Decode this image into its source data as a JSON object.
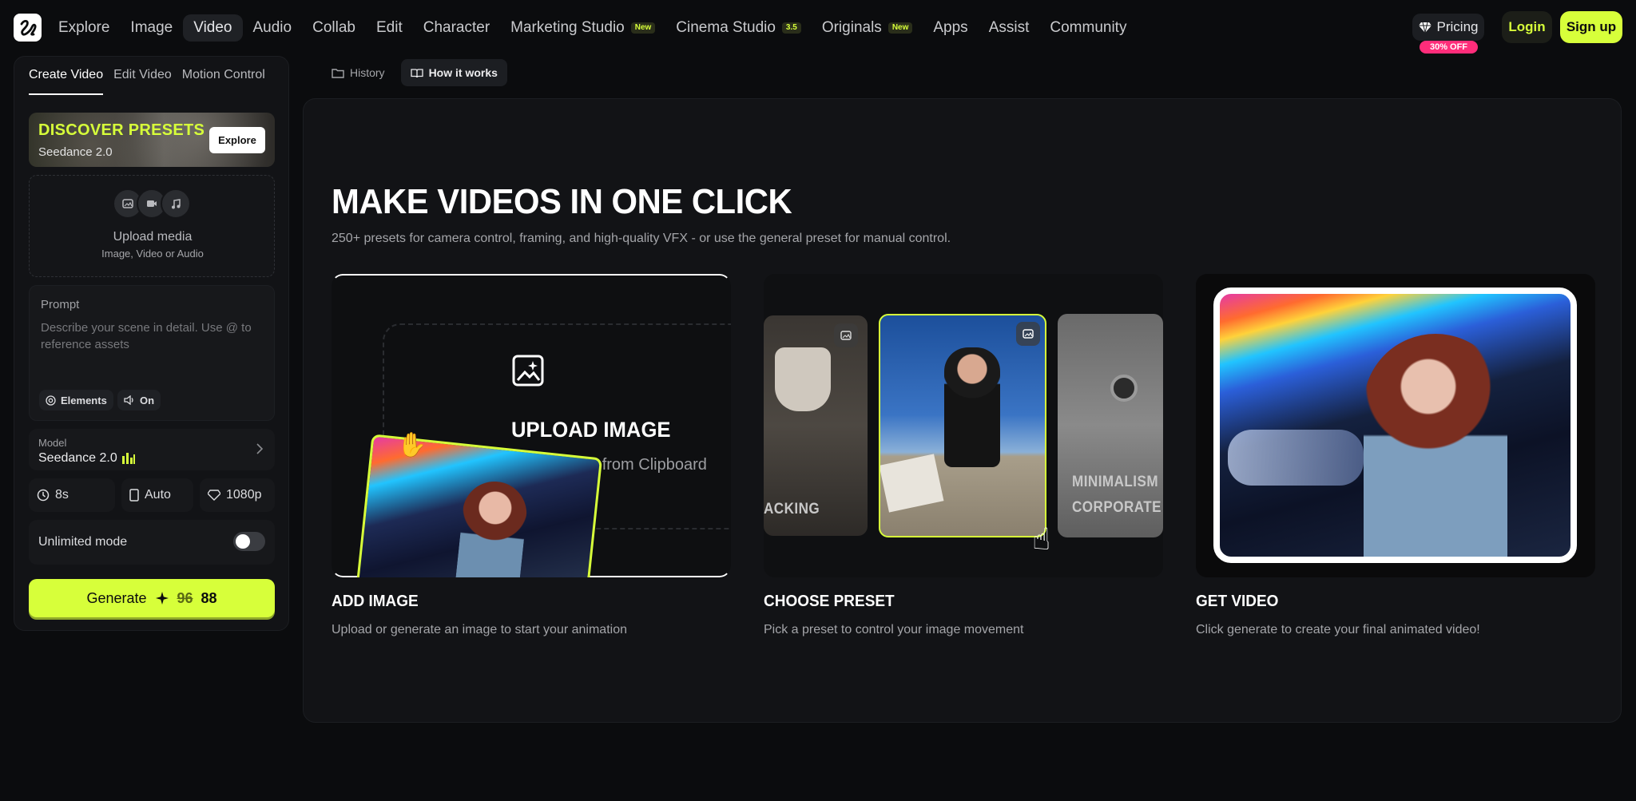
{
  "nav": {
    "items": [
      {
        "label": "Explore"
      },
      {
        "label": "Image"
      },
      {
        "label": "Video"
      },
      {
        "label": "Audio"
      },
      {
        "label": "Collab"
      },
      {
        "label": "Edit"
      },
      {
        "label": "Character"
      },
      {
        "label": "Marketing Studio",
        "badge": "New"
      },
      {
        "label": "Cinema Studio",
        "badge": "3.5"
      },
      {
        "label": "Originals",
        "badge": "New"
      },
      {
        "label": "Apps"
      },
      {
        "label": "Assist"
      },
      {
        "label": "Community"
      }
    ],
    "active": "Video",
    "pricing": "Pricing",
    "discount": "30% OFF",
    "login": "Login",
    "signup": "Sign up"
  },
  "sidebar": {
    "tabs": [
      "Create Video",
      "Edit Video",
      "Motion Control"
    ],
    "active_tab": "Create Video",
    "presets": {
      "title": "DISCOVER PRESETS",
      "subtitle": "Seedance 2.0",
      "button": "Explore"
    },
    "upload": {
      "title": "Upload media",
      "subtitle": "Image, Video or Audio",
      "icons": [
        "image-icon",
        "video-icon",
        "music-icon"
      ]
    },
    "prompt": {
      "label": "Prompt",
      "placeholder": "Describe your scene in detail. Use @ to reference assets",
      "elements_chip": "Elements",
      "audio_chip": "On"
    },
    "model": {
      "label": "Model",
      "value": "Seedance 2.0"
    },
    "options": {
      "duration": "8s",
      "aspect": "Auto",
      "resolution": "1080p"
    },
    "unlimited": {
      "label": "Unlimited mode",
      "enabled": false
    },
    "generate": {
      "label": "Generate",
      "old_cost": "96",
      "cost": "88"
    }
  },
  "main": {
    "subtabs": [
      "History",
      "How it works"
    ],
    "active_subtab": "How it works",
    "hero": {
      "title": "MAKE VIDEOS IN ONE CLICK",
      "subtitle": "250+ presets for camera control, framing, and high-quality VFX - or use the general preset for manual control."
    },
    "steps": [
      {
        "title": "ADD IMAGE",
        "desc": "Upload or generate an image to start your animation"
      },
      {
        "title": "CHOOSE PRESET",
        "desc": "Pick a preset to control your image movement"
      },
      {
        "title": "GET VIDEO",
        "desc": "Click generate to create your final animated video!"
      }
    ],
    "card1": {
      "upload_text": "UPLOAD IMAGE",
      "paste_text": "Paste from Clipboard"
    },
    "card2": {
      "preset_left": "ACKING",
      "preset_right_1": "MINIMALISM",
      "preset_right_2": "CORPORATE"
    }
  },
  "colors": {
    "accent": "#d7ff3a",
    "background": "#0b0c0e",
    "panel": "#121316",
    "discount": "#ff2d7a"
  }
}
